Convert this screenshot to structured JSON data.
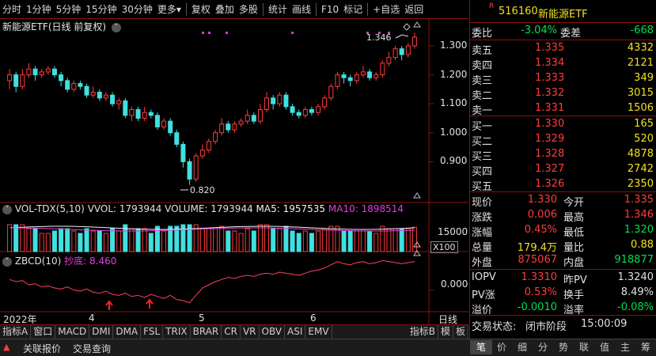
{
  "toolbar": {
    "items": [
      "分时",
      "1分钟",
      "5分钟",
      "15分钟",
      "30分钟",
      "更多",
      "复权",
      "叠加",
      "多股",
      "统计",
      "画线",
      "F10",
      "标记",
      "+自选",
      "返回"
    ]
  },
  "chart_title": {
    "name": "新能源ETF",
    "mode": "(日线 前复权)"
  },
  "price_axis": [
    "1.300",
    "1.200",
    "1.100",
    "1.000",
    "0.900"
  ],
  "annotations": {
    "high": "1.346",
    "low": "0.820"
  },
  "volume_header": {
    "label": "VOL-TDX(5,10)",
    "vvol": "VVOL: 1793944",
    "volume": "VOLUME: 1793944",
    "ma5": "MA5: 1957535",
    "ma10": "MA10: 1898514"
  },
  "volume_axis": {
    "tick": "15000",
    "unit": "X100"
  },
  "indicator_header": {
    "label": "ZBCD(10)",
    "name": "抄底:",
    "value": "8.460"
  },
  "indicator_axis": "0.000",
  "date_axis": {
    "year": "2022年",
    "m4": "4",
    "m5": "5",
    "m6": "6",
    "period": "日线"
  },
  "indicator_tabs": [
    "指标A",
    "窗口",
    "MACD",
    "DMI",
    "DMA",
    "FSL",
    "TRIX",
    "BRAR",
    "CR",
    "VR",
    "OBV",
    "ASI",
    "EMV"
  ],
  "indicator_tabs_right": [
    "指标B",
    "模",
    "板"
  ],
  "quote": {
    "code": "516160",
    "name": "新能源ETF",
    "weibi_label": "委比",
    "weibi": "-3.04%",
    "weicha_label": "委差",
    "weicha": "-668",
    "asks": [
      {
        "label": "卖五",
        "price": "1.335",
        "vol": "4332"
      },
      {
        "label": "卖四",
        "price": "1.334",
        "vol": "2121"
      },
      {
        "label": "卖三",
        "price": "1.333",
        "vol": "349"
      },
      {
        "label": "卖二",
        "price": "1.332",
        "vol": "3015"
      },
      {
        "label": "卖一",
        "price": "1.331",
        "vol": "1506"
      }
    ],
    "bids": [
      {
        "label": "买一",
        "price": "1.330",
        "vol": "165"
      },
      {
        "label": "买二",
        "price": "1.329",
        "vol": "520"
      },
      {
        "label": "买三",
        "price": "1.328",
        "vol": "4878"
      },
      {
        "label": "买四",
        "price": "1.327",
        "vol": "2742"
      },
      {
        "label": "买五",
        "price": "1.326",
        "vol": "2350"
      }
    ],
    "stats": [
      {
        "l1": "现价",
        "v1": "1.330",
        "l2": "今开",
        "v2": "1.335",
        "c1": "red",
        "c2": "red"
      },
      {
        "l1": "涨跌",
        "v1": "0.006",
        "l2": "最高",
        "v2": "1.346",
        "c1": "red",
        "c2": "red"
      },
      {
        "l1": "涨幅",
        "v1": "0.45%",
        "l2": "最低",
        "v2": "1.320",
        "c1": "red",
        "c2": "green"
      },
      {
        "l1": "总量",
        "v1": "179.4万",
        "l2": "量比",
        "v2": "0.88",
        "c1": "yellow",
        "c2": "yellow"
      },
      {
        "l1": "外盘",
        "v1": "875067",
        "l2": "内盘",
        "v2": "918877",
        "c1": "red",
        "c2": "green"
      }
    ],
    "extra": [
      {
        "l1": "IOPV",
        "v1": "1.3310",
        "l2": "昨PV",
        "v2": "1.3240",
        "c1": "red",
        "c2": "white"
      },
      {
        "l1": "PV涨",
        "v1": "0.53%",
        "l2": "换手",
        "v2": "8.49%",
        "c1": "red",
        "c2": "white"
      },
      {
        "l1": "溢价",
        "v1": "-0.0010",
        "l2": "溢率",
        "v2": "-0.08%",
        "c1": "green",
        "c2": "green"
      }
    ],
    "trade_status_label": "交易状态:",
    "trade_status": "闭市阶段",
    "trade_time": "15:00:09"
  },
  "right_tabs": [
    "笔",
    "价",
    "细",
    "分",
    "势",
    "联",
    "值",
    "主",
    "筹"
  ],
  "status_bar": {
    "quote": "关联报价",
    "query": "交易查询"
  },
  "chart_data": {
    "type": "candlestick",
    "y_range": [
      0.8,
      1.36
    ],
    "candles": [
      [
        1.18,
        1.2,
        1.22,
        1.15
      ],
      [
        1.2,
        1.16,
        1.21,
        1.14
      ],
      [
        1.16,
        1.2,
        1.22,
        1.15
      ],
      [
        1.2,
        1.22,
        1.24,
        1.19
      ],
      [
        1.22,
        1.2,
        1.23,
        1.18
      ],
      [
        1.2,
        1.21,
        1.22,
        1.19
      ],
      [
        1.21,
        1.22,
        1.23,
        1.2
      ],
      [
        1.22,
        1.2,
        1.23,
        1.19
      ],
      [
        1.2,
        1.18,
        1.21,
        1.16
      ],
      [
        1.18,
        1.15,
        1.19,
        1.14
      ],
      [
        1.15,
        1.17,
        1.18,
        1.14
      ],
      [
        1.17,
        1.16,
        1.18,
        1.15
      ],
      [
        1.16,
        1.13,
        1.17,
        1.12
      ],
      [
        1.13,
        1.14,
        1.16,
        1.12
      ],
      [
        1.14,
        1.12,
        1.15,
        1.11
      ],
      [
        1.12,
        1.13,
        1.14,
        1.11
      ],
      [
        1.13,
        1.1,
        1.14,
        1.09
      ],
      [
        1.1,
        1.11,
        1.12,
        1.08
      ],
      [
        1.11,
        1.06,
        1.12,
        1.05
      ],
      [
        1.06,
        1.08,
        1.09,
        1.04
      ],
      [
        1.08,
        1.05,
        1.09,
        1.04
      ],
      [
        1.05,
        1.07,
        1.09,
        1.04
      ],
      [
        1.07,
        1.06,
        1.08,
        1.05
      ],
      [
        1.06,
        1.02,
        1.07,
        1.01
      ],
      [
        1.02,
        1.04,
        1.05,
        1.01
      ],
      [
        1.04,
        1.0,
        1.05,
        0.99
      ],
      [
        1.0,
        0.96,
        1.01,
        0.95
      ],
      [
        0.96,
        0.9,
        0.97,
        0.88
      ],
      [
        0.9,
        0.84,
        0.91,
        0.82
      ],
      [
        0.84,
        0.92,
        0.93,
        0.83
      ],
      [
        0.92,
        0.94,
        0.96,
        0.91
      ],
      [
        0.94,
        0.97,
        0.98,
        0.93
      ],
      [
        0.97,
        1.0,
        1.01,
        0.96
      ],
      [
        1.0,
        1.03,
        1.05,
        0.99
      ],
      [
        1.03,
        1.01,
        1.04,
        1.0
      ],
      [
        1.01,
        1.03,
        1.04,
        1.0
      ],
      [
        1.03,
        1.04,
        1.05,
        1.02
      ],
      [
        1.04,
        1.06,
        1.08,
        1.03
      ],
      [
        1.06,
        1.04,
        1.07,
        1.03
      ],
      [
        1.04,
        1.08,
        1.1,
        1.03
      ],
      [
        1.08,
        1.12,
        1.14,
        1.07
      ],
      [
        1.12,
        1.1,
        1.13,
        1.08
      ],
      [
        1.1,
        1.13,
        1.14,
        1.09
      ],
      [
        1.13,
        1.09,
        1.14,
        1.08
      ],
      [
        1.09,
        1.07,
        1.1,
        1.06
      ],
      [
        1.07,
        1.06,
        1.08,
        1.05
      ],
      [
        1.06,
        1.08,
        1.09,
        1.05
      ],
      [
        1.08,
        1.07,
        1.09,
        1.06
      ],
      [
        1.07,
        1.09,
        1.1,
        1.06
      ],
      [
        1.09,
        1.12,
        1.13,
        1.08
      ],
      [
        1.12,
        1.16,
        1.17,
        1.11
      ],
      [
        1.16,
        1.2,
        1.21,
        1.15
      ],
      [
        1.2,
        1.19,
        1.21,
        1.17
      ],
      [
        1.19,
        1.18,
        1.2,
        1.16
      ],
      [
        1.18,
        1.2,
        1.21,
        1.17
      ],
      [
        1.2,
        1.21,
        1.23,
        1.19
      ],
      [
        1.21,
        1.19,
        1.22,
        1.18
      ],
      [
        1.19,
        1.2,
        1.21,
        1.18
      ],
      [
        1.2,
        1.24,
        1.25,
        1.19
      ],
      [
        1.24,
        1.26,
        1.28,
        1.23
      ],
      [
        1.26,
        1.29,
        1.3,
        1.25
      ],
      [
        1.29,
        1.27,
        1.3,
        1.25
      ],
      [
        1.27,
        1.3,
        1.31,
        1.26
      ],
      [
        1.3,
        1.33,
        1.346,
        1.29
      ]
    ],
    "volume_range": [
      0,
      24000
    ],
    "indicator_line": [
      0.1,
      0.08,
      0.09,
      0.05,
      0.06,
      0.03,
      0.04,
      0.02,
      0.01,
      0.03,
      0.0,
      -0.01,
      0.01,
      -0.02,
      -0.03,
      -0.01,
      -0.04,
      -0.05,
      -0.03,
      -0.06,
      -0.05,
      -0.07,
      -0.04,
      -0.06,
      -0.08,
      -0.05,
      -0.09,
      -0.1,
      -0.12,
      -0.05,
      0.02,
      0.05,
      0.08,
      0.1,
      0.12,
      0.11,
      0.13,
      0.14,
      0.13,
      0.15,
      0.16,
      0.15,
      0.17,
      0.16,
      0.15,
      0.14,
      0.16,
      0.18,
      0.19,
      0.21,
      0.24,
      0.27,
      0.25,
      0.24,
      0.26,
      0.27,
      0.25,
      0.26,
      0.28,
      0.27,
      0.26,
      0.25,
      0.26,
      0.27
    ],
    "indicator_range": [
      -0.16,
      0.32
    ]
  }
}
